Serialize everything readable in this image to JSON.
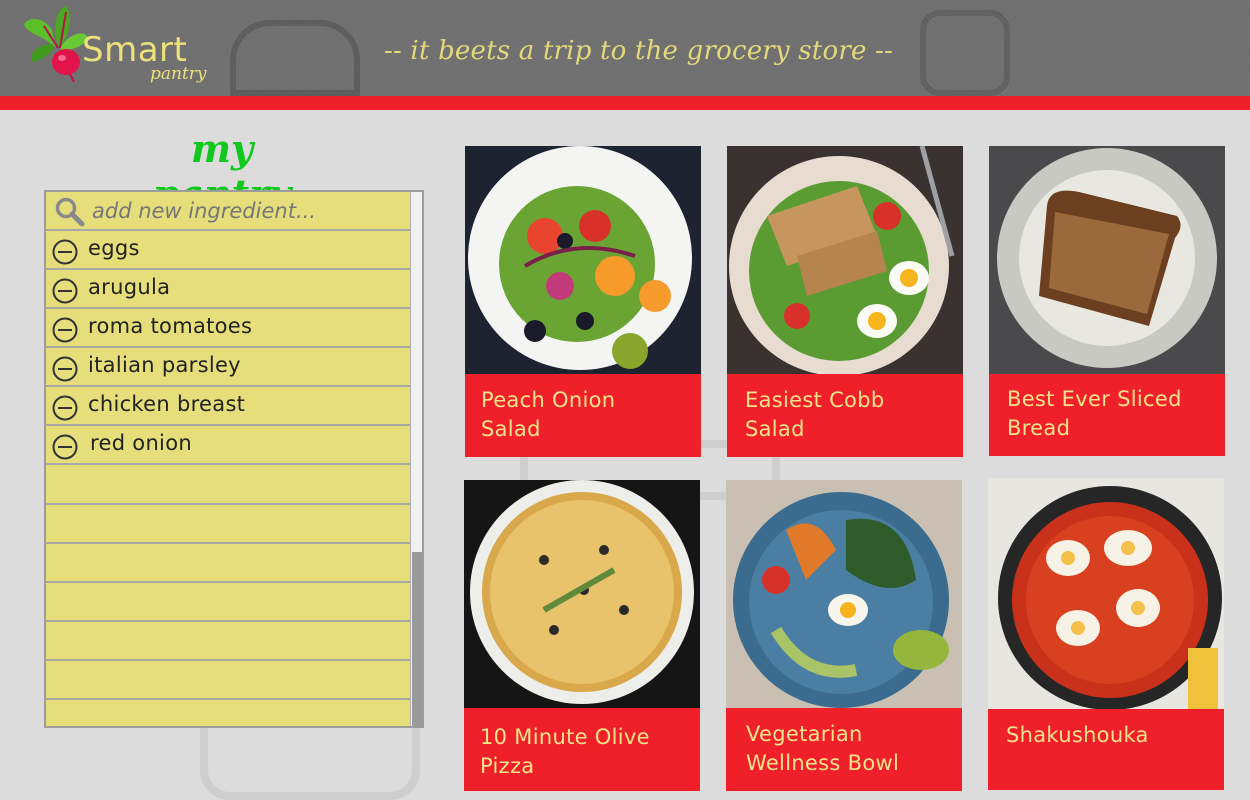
{
  "header": {
    "logo_title": "Smart",
    "logo_subtitle": "pantry",
    "tagline": "-- it beets a trip to the grocery store --"
  },
  "pantry": {
    "title": "my pantry",
    "search_placeholder": "add new ingredient...",
    "items": [
      {
        "label": "eggs"
      },
      {
        "label": "arugula"
      },
      {
        "label": "roma tomatoes"
      },
      {
        "label": "italian parsley"
      },
      {
        "label": "chicken breast"
      },
      {
        "label": "red onion"
      }
    ]
  },
  "recipes": [
    {
      "title": "Peach Onion Salad",
      "line1": "Peach Onion",
      "line2": "Salad",
      "photo": "salad-plate-photo"
    },
    {
      "title": "Easiest Cobb Salad",
      "line1": "Easiest Cobb",
      "line2": "Salad",
      "photo": "chicken-salad-photo"
    },
    {
      "title": "Best Ever Sliced Bread",
      "line1": "Best Ever Sliced",
      "line2": "Bread",
      "photo": "bread-plate-photo"
    },
    {
      "title": "10 Minute Olive Pizza",
      "line1": "10 Minute Olive",
      "line2": "Pizza",
      "photo": "pizza-photo"
    },
    {
      "title": "Vegetarian Wellness Bowl",
      "line1": "Vegetarian",
      "line2": "Wellness Bowl",
      "photo": "veggie-bowl-photo"
    },
    {
      "title": "Shakushouka",
      "line1": "Shakushouka",
      "line2": "",
      "photo": "shakshuka-pan-photo"
    }
  ],
  "colors": {
    "accent_red": "#f0202a",
    "pantry_yellow": "#e5de7b",
    "pantry_title_green": "#12c81f",
    "tagline_yellow": "#e3d97a",
    "caption_yellow": "#f1e38c"
  }
}
